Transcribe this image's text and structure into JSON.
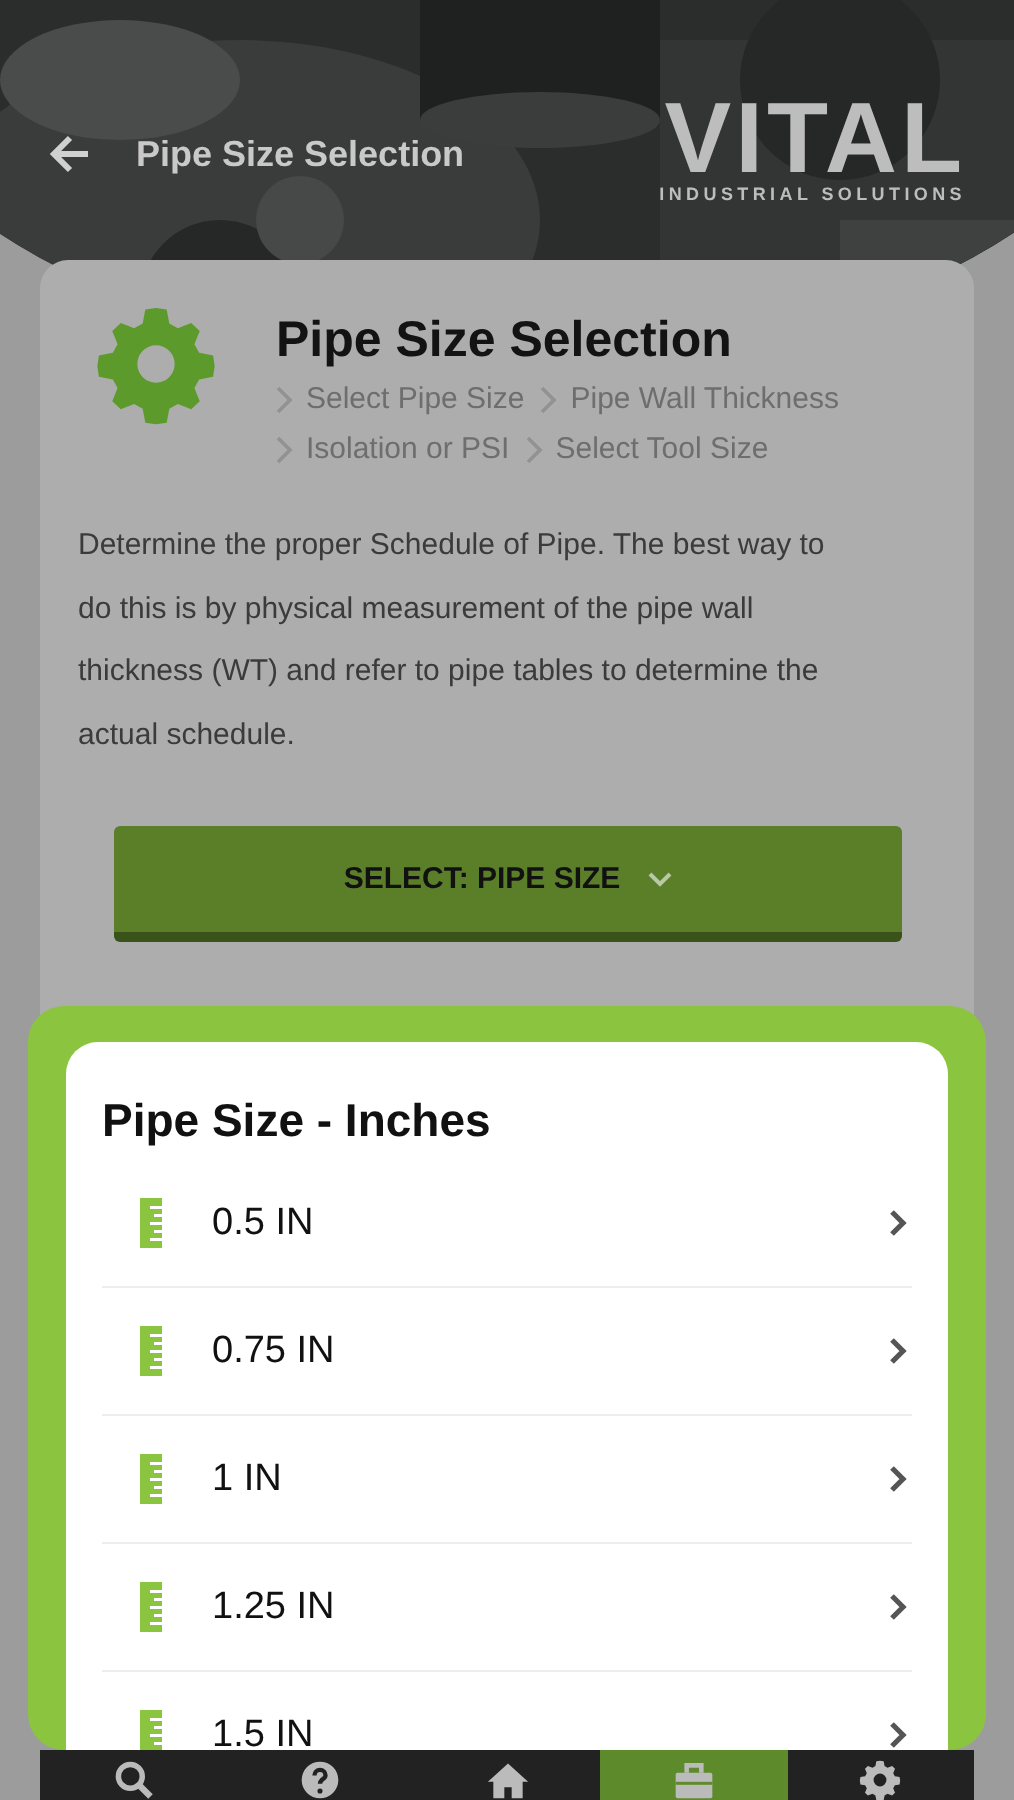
{
  "header": {
    "title": "Pipe Size Selection",
    "logo": {
      "wordmark": "VITAL",
      "tagline": "INDUSTRIAL SOLUTIONS"
    }
  },
  "card": {
    "title": "Pipe Size Selection",
    "steps": [
      "Select Pipe Size",
      "Pipe Wall Thickness",
      "Isolation or PSI",
      "Select Tool Size"
    ],
    "description": "Determine the proper Schedule of Pipe. The best way to do this is by physical measurement of the pipe wall thickness (WT) and refer to pipe tables to determine the actual schedule.",
    "select_button": "SELECT: PIPE SIZE"
  },
  "sheet": {
    "title": "Pipe Size - Inches",
    "options": [
      "0.5 IN",
      "0.75 IN",
      "1 IN",
      "1.25 IN",
      "1.5 IN"
    ]
  },
  "tab_bar": [
    {
      "kind": "search",
      "selected": false
    },
    {
      "kind": "help",
      "selected": false
    },
    {
      "kind": "home",
      "selected": false
    },
    {
      "kind": "toolbox",
      "selected": true
    },
    {
      "kind": "settings",
      "selected": false
    }
  ]
}
